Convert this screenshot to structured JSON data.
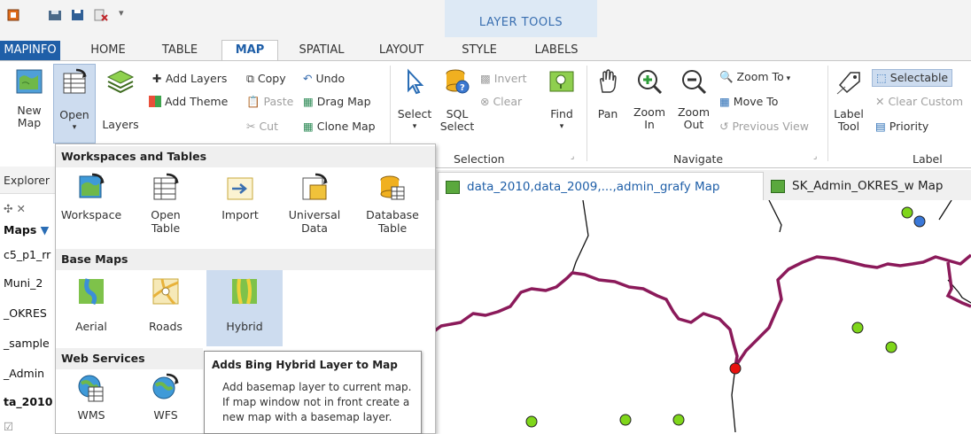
{
  "ribbon_tabs": {
    "mapinfo": "MAPINFO",
    "home": "HOME",
    "table": "TABLE",
    "map": "MAP",
    "spatial": "SPATIAL",
    "layout": "LAYOUT",
    "style": "STYLE",
    "labels": "LABELS",
    "context_group": "LAYER TOOLS"
  },
  "ribbon": {
    "new_map": [
      "New",
      "Map"
    ],
    "open": "Open",
    "layers": "Layers",
    "add_layers": "Add Layers",
    "add_theme": "Add Theme",
    "copy": "Copy",
    "paste": "Paste",
    "cut": "Cut",
    "undo": "Undo",
    "drag_map": "Drag Map",
    "clone_map": "Clone Map",
    "select": "Select",
    "sql_select": [
      "SQL",
      "Select"
    ],
    "invert": "Invert",
    "clear": "Clear",
    "find": "Find",
    "pan": "Pan",
    "zoom_in": [
      "Zoom",
      "In"
    ],
    "zoom_out": [
      "Zoom",
      "Out"
    ],
    "zoom_to": "Zoom To",
    "move_to": "Move To",
    "previous_view": "Previous View",
    "label_tool": [
      "Label",
      "Tool"
    ],
    "selectable": "Selectable",
    "clear_custom": "Clear Custom",
    "priority": "Priority",
    "groups": {
      "selection": "Selection",
      "navigate": "Navigate",
      "label": "Label"
    }
  },
  "explorer": {
    "title": "Explorer",
    "maps": "Maps",
    "items": [
      "c5_p1_rr",
      "Muni_2",
      "_OKRES",
      "_sample",
      "_Admin",
      "ta_2010"
    ]
  },
  "map_tabs": [
    "data_2010,data_2009,...,admin_grafy Map",
    "SK_Admin_OKRES_w Map"
  ],
  "dropdown": {
    "sections": [
      "Workspaces and Tables",
      "Base Maps",
      "Web Services"
    ],
    "workspaces": [
      [
        "Workspace"
      ],
      [
        "Open",
        "Table"
      ],
      [
        "Import"
      ],
      [
        "Universal",
        "Data"
      ],
      [
        "Database",
        "Table"
      ]
    ],
    "basemaps": [
      "Aerial",
      "Roads",
      "Hybrid"
    ],
    "webservices": [
      "WMS",
      "WFS"
    ]
  },
  "tooltip": {
    "title": "Adds Bing Hybrid Layer to Map",
    "body": "Add basemap layer to current map. If map window not in front create a new map with a basemap layer."
  },
  "colors": {
    "accent": "#1f5fa8",
    "boundary": "#8b1a5a",
    "point_green": "#7fd61a",
    "point_blue": "#3a78d8",
    "point_red": "#e8110f",
    "selected_bg": "#cddcef"
  }
}
